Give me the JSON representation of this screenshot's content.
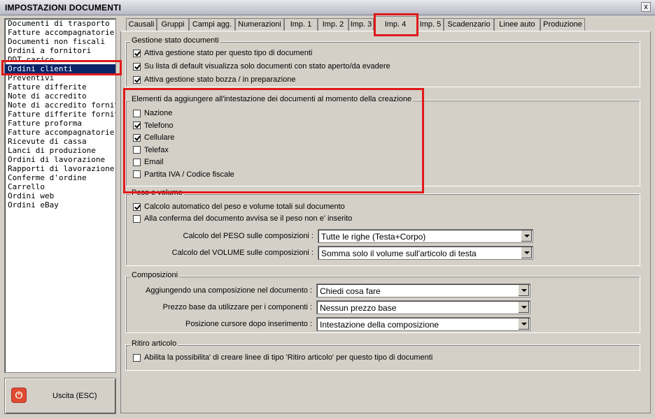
{
  "window": {
    "title": "IMPOSTAZIONI DOCUMENTI",
    "close_glyph": "x"
  },
  "left_list": {
    "items": [
      "Documenti di trasporto",
      "Fatture accompagnatorie",
      "Documenti non fiscali",
      "Ordini a fornitori",
      "DDT carico",
      "Ordini clienti",
      "Preventivi",
      "Fatture differite",
      "Note di accredito",
      "Note di accredito fornitori",
      "Fatture differite fornitori",
      "Fatture proforma",
      "Fatture accompagnatorie fc",
      "Ricevute di cassa",
      "Lanci di produzione",
      "Ordini di lavorazione",
      "Rapporti di lavorazione",
      "Conferme d'ordine",
      "Carrello",
      "Ordini web",
      "Ordini eBay"
    ],
    "selected": "Ordini clienti"
  },
  "exit_button": {
    "label": "Uscita (ESC)",
    "icon": "power-icon"
  },
  "tabs": [
    "Causali",
    "Gruppi",
    "Campi agg.",
    "Numerazioni",
    "Imp. 1",
    "Imp. 2",
    "Imp. 3",
    "Imp. 4",
    "Imp. 5",
    "Scadenzario",
    "Linee auto",
    "Produzione"
  ],
  "active_tab": "Imp. 4",
  "gestione": {
    "title": "Gestione stato documenti",
    "items": [
      {
        "label": "Attiva gestione stato per questo tipo di documenti",
        "checked": true
      },
      {
        "label": "Su lista di default visualizza solo documenti con stato aperto/da evadere",
        "checked": true
      },
      {
        "label": "Attiva gestione stato bozza / in preparazione",
        "checked": true
      }
    ]
  },
  "intestazione": {
    "title": "Elementi da aggiungere all'intestazione dei documenti al momento della creazione",
    "items": [
      {
        "label": "Nazione",
        "checked": false
      },
      {
        "label": "Telefono",
        "checked": true
      },
      {
        "label": "Cellulare",
        "checked": true
      },
      {
        "label": "Telefax",
        "checked": false
      },
      {
        "label": "Email",
        "checked": false
      },
      {
        "label": "Partita IVA / Codice fiscale",
        "checked": false
      }
    ]
  },
  "peso": {
    "title": "Peso e volume",
    "items": [
      {
        "label": "Calcolo automatico del peso e volume totali sul documento",
        "checked": true
      },
      {
        "label": "Alla conferma del documento avvisa se il peso non e' inserito",
        "checked": false
      }
    ],
    "fields": [
      {
        "label": "Calcolo del PESO sulle composizioni :",
        "value": "Tutte le righe (Testa+Corpo)"
      },
      {
        "label": "Calcolo del VOLUME sulle composizioni :",
        "value": "Somma solo il volume sull'articolo di testa"
      }
    ]
  },
  "composizioni": {
    "title": "Composizioni",
    "fields": [
      {
        "label": "Aggiungendo una composizione nel documento :",
        "value": "Chiedi cosa fare"
      },
      {
        "label": "Prezzo base da utilizzare per i componenti :",
        "value": "Nessun prezzo base"
      },
      {
        "label": "Posizione cursore dopo inserimento :",
        "value": "Intestazione della composizione"
      }
    ]
  },
  "ritiro": {
    "title": "Ritiro articolo",
    "items": [
      {
        "label": "Abilita la possibilita' di creare linee di tipo 'Ritiro articolo' per questo tipo di documenti",
        "checked": false
      }
    ]
  },
  "highlight_color": "#e0191b"
}
